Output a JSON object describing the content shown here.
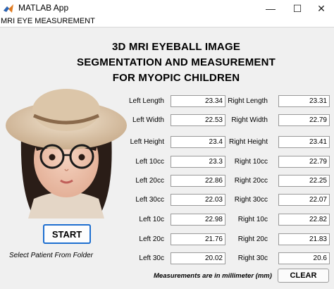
{
  "window": {
    "title": "MATLAB App",
    "icon": "matlab-icon",
    "controls": {
      "minimize": "—",
      "maximize": "☐",
      "close": "✕"
    }
  },
  "menu": {
    "label": "MRI EYE MEASUREMENT"
  },
  "heading": {
    "line1": "3D MRI EYEBALL IMAGE",
    "line2": "SEGMENTATION AND MEASUREMENT",
    "line3": "FOR MYOPIC CHILDREN"
  },
  "actions": {
    "start_label": "START",
    "select_note": "Select Patient From Folder",
    "clear_label": "CLEAR"
  },
  "left": [
    {
      "label": "Left Length",
      "value": "23.34"
    },
    {
      "label": "Left Width",
      "value": "22.53"
    },
    {
      "label": "Left Height",
      "value": "23.4"
    },
    {
      "label": "Left 10cc",
      "value": "23.3"
    },
    {
      "label": "Left 20cc",
      "value": "22.86"
    },
    {
      "label": "Left 30cc",
      "value": "22.03"
    },
    {
      "label": "Left 10c",
      "value": "22.98"
    },
    {
      "label": "Left 20c",
      "value": "21.76"
    },
    {
      "label": "Left 30c",
      "value": "20.02"
    }
  ],
  "right": [
    {
      "label": "Right Length",
      "value": "23.31"
    },
    {
      "label": "Right Width",
      "value": "22.79"
    },
    {
      "label": "Right Height",
      "value": "23.41"
    },
    {
      "label": "Right 10cc",
      "value": "22.79"
    },
    {
      "label": "Right 20cc",
      "value": "22.25"
    },
    {
      "label": "Right 30cc",
      "value": "22.07"
    },
    {
      "label": "Right 10c",
      "value": "22.82"
    },
    {
      "label": "Right 20c",
      "value": "21.83"
    },
    {
      "label": "Right 30c",
      "value": "20.6"
    }
  ],
  "footer": {
    "note": "Measurements are in millimeter (mm)"
  },
  "colors": {
    "start_border": "#1e6fd0",
    "window_bg": "#f0f0f0"
  }
}
